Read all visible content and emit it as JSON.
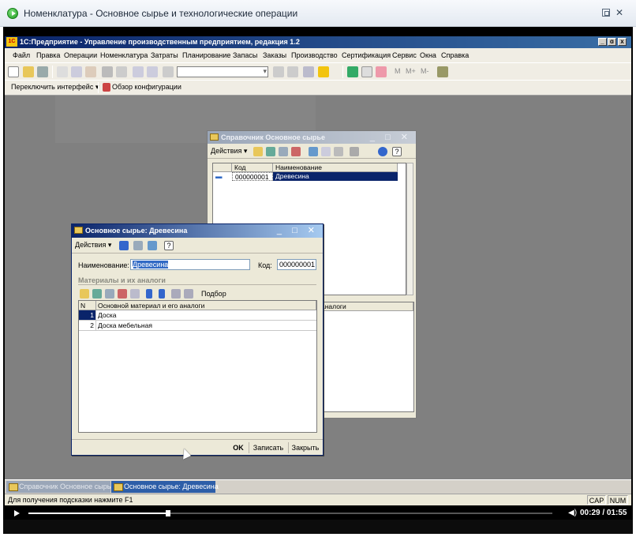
{
  "viewer": {
    "title": "Номенклатура - Основное сырье и технологические операции"
  },
  "app": {
    "title": "1С:Предприятие - Управление производственным предприятием, редакция 1.2",
    "logo": "1С",
    "window_buttons": [
      "_",
      "ɑ",
      "x"
    ]
  },
  "menu": {
    "items": [
      "Файл",
      "Правка",
      "Операции",
      "Номенклатура",
      "Затраты",
      "Планирование",
      "Запасы",
      "Заказы",
      "Производство",
      "Сертификация",
      "Сервис",
      "Окна",
      "Справка"
    ]
  },
  "toolbar": {
    "m_labels": [
      "M",
      "M+",
      "M-"
    ]
  },
  "toolbar2": {
    "switch_interface": "Переключить интерфейс ▾",
    "config_overview": "Обзор конфигурации"
  },
  "catalog": {
    "title": "Справочник Основное сырье",
    "actions": "Действия ▾",
    "col_code": "Код",
    "col_name": "Наименование",
    "row_code": "000000001",
    "row_name": "Древесина",
    "lower_header": "аналоги"
  },
  "element": {
    "title": "Основное сырье: Древесина",
    "actions": "Действия ▾",
    "name_label": "Наименование:",
    "name_value": "Древесина",
    "code_label": "Код:",
    "code_value": "000000001",
    "section": "Материалы и их аналоги",
    "pick_button": "Подбор",
    "col_number": "N",
    "col_material": "Основной материал и его аналоги",
    "rows": [
      {
        "n": "1",
        "text": "Доска"
      },
      {
        "n": "2",
        "text": "Доска мебельная"
      }
    ],
    "ok": "OK",
    "save": "Записать",
    "close": "Закрыть"
  },
  "taskbar": {
    "tasks": [
      "Справочник Основное сырье",
      "Основное сырье: Древесина"
    ]
  },
  "status": {
    "hint": "Для получения подсказки нажмите F1",
    "cap": "CAP",
    "num": "NUM"
  },
  "player": {
    "time": "00:29 / 01:55",
    "progress": 0.266
  },
  "colors": {
    "titlebar_active": "#0a246a",
    "selection": "#316ac5",
    "workspace": "#808080"
  }
}
